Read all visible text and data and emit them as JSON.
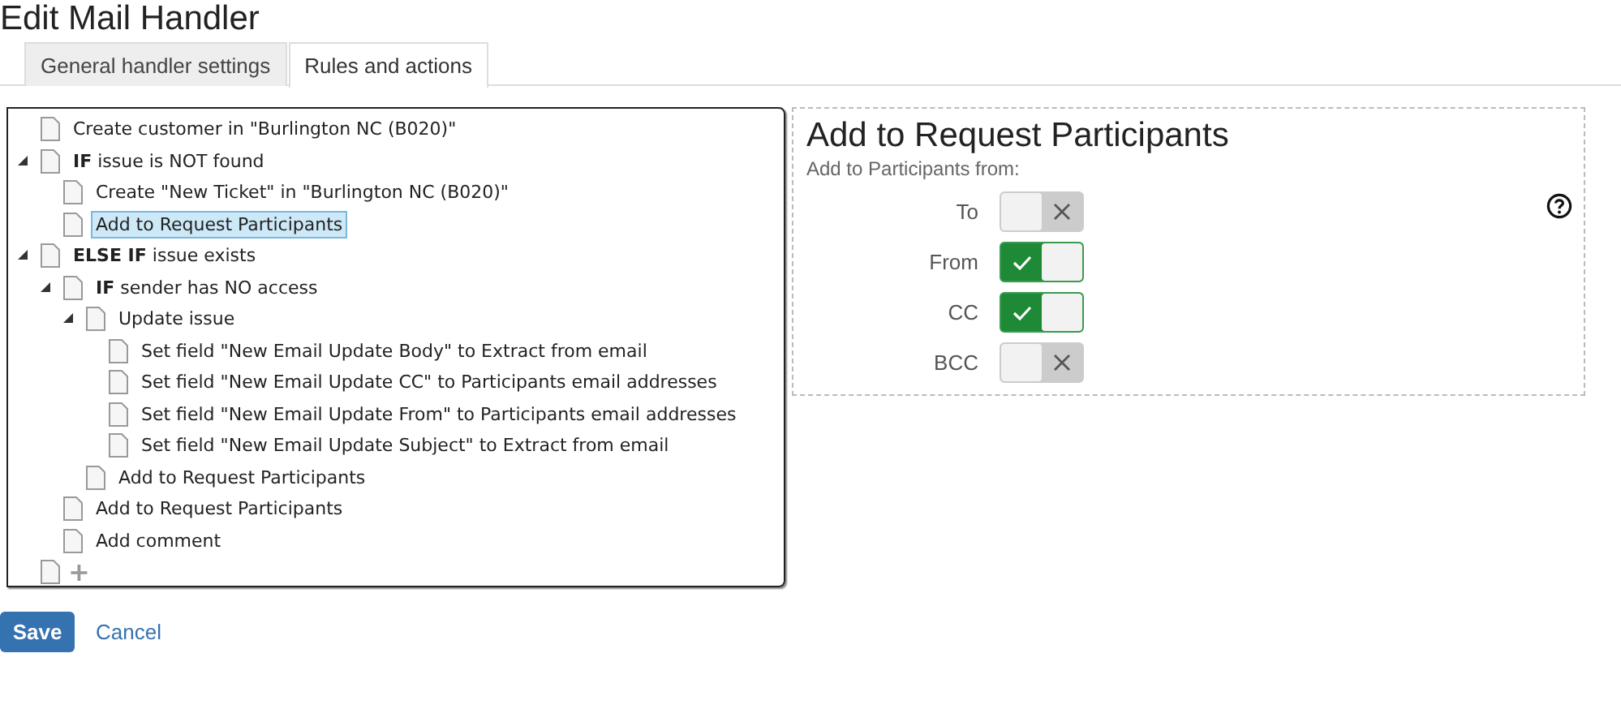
{
  "page_title": "Edit Mail Handler",
  "tabs": [
    {
      "label": "General handler settings",
      "selected": false
    },
    {
      "label": "Rules and actions",
      "selected": true
    }
  ],
  "tree": [
    {
      "label": "Create customer in \"Burlington NC (B020)\"",
      "selected": false
    },
    {
      "label": "**IF** issue is NOT found",
      "selected": false,
      "expanded": true,
      "children": [
        {
          "label": "Create \"New Ticket\" in \"Burlington NC (B020)\"",
          "selected": false
        },
        {
          "label": "Add to Request Participants",
          "selected": true
        }
      ]
    },
    {
      "label": "**ELSE IF** issue exists",
      "selected": false,
      "expanded": true,
      "children": [
        {
          "label": "**IF** sender has NO access",
          "selected": false,
          "expanded": true,
          "children": [
            {
              "label": "Update issue",
              "selected": false,
              "expanded": true,
              "children": [
                {
                  "label": "Set field \"New Email Update Body\" to Extract from email",
                  "selected": false
                },
                {
                  "label": "Set field \"New Email Update CC\" to Participants email addresses",
                  "selected": false
                },
                {
                  "label": "Set field \"New Email Update From\" to Participants email addresses",
                  "selected": false
                },
                {
                  "label": "Set field \"New Email Update Subject\" to Extract from email",
                  "selected": false
                }
              ]
            },
            {
              "label": "Add to Request Participants",
              "selected": false
            }
          ]
        },
        {
          "label": "Add to Request Participants",
          "selected": false
        },
        {
          "label": "Add comment",
          "selected": false
        }
      ]
    }
  ],
  "tree_add_row": {
    "label": "+"
  },
  "panel": {
    "title": "Add to Request Participants",
    "subtitle": "Add to Participants from:",
    "toggles": [
      {
        "label": "To",
        "on": false
      },
      {
        "label": "From",
        "on": true
      },
      {
        "label": "CC",
        "on": true
      },
      {
        "label": "BCC",
        "on": false
      }
    ]
  },
  "buttons": {
    "save": "Save",
    "cancel": "Cancel"
  }
}
